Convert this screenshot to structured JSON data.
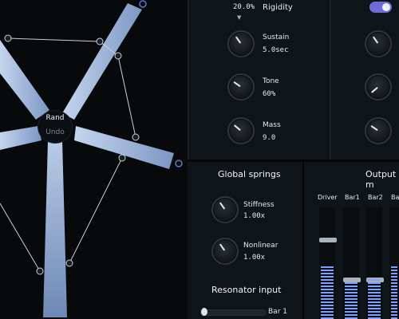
{
  "stage": {
    "hub": {
      "rand": "Rand",
      "undo": "Undo"
    }
  },
  "top_panel": {
    "rigidity": {
      "value": "20.0%",
      "label": "Rigidity"
    },
    "sustain": {
      "label": "Sustain",
      "value": "5.0sec"
    },
    "tone": {
      "label": "Tone",
      "value": "60%"
    },
    "mass": {
      "label": "Mass",
      "value": "9.0"
    },
    "toggle": {
      "state": "on",
      "color": "#6e6cd6"
    }
  },
  "global_springs": {
    "title": "Global springs",
    "stiffness": {
      "label": "Stiffness",
      "value": "1.00x"
    },
    "nonlinear": {
      "label": "Nonlinear",
      "value": "1.00x"
    }
  },
  "resonator": {
    "title": "Resonator input",
    "selected": "Bar 1"
  },
  "output": {
    "title": "Output m",
    "columns": [
      "Driver",
      "Bar1",
      "Bar2",
      "Ba"
    ]
  },
  "colors": {
    "meter": "#7fa0ff",
    "panel": "#0f1418",
    "accent": "#6e6cd6"
  }
}
